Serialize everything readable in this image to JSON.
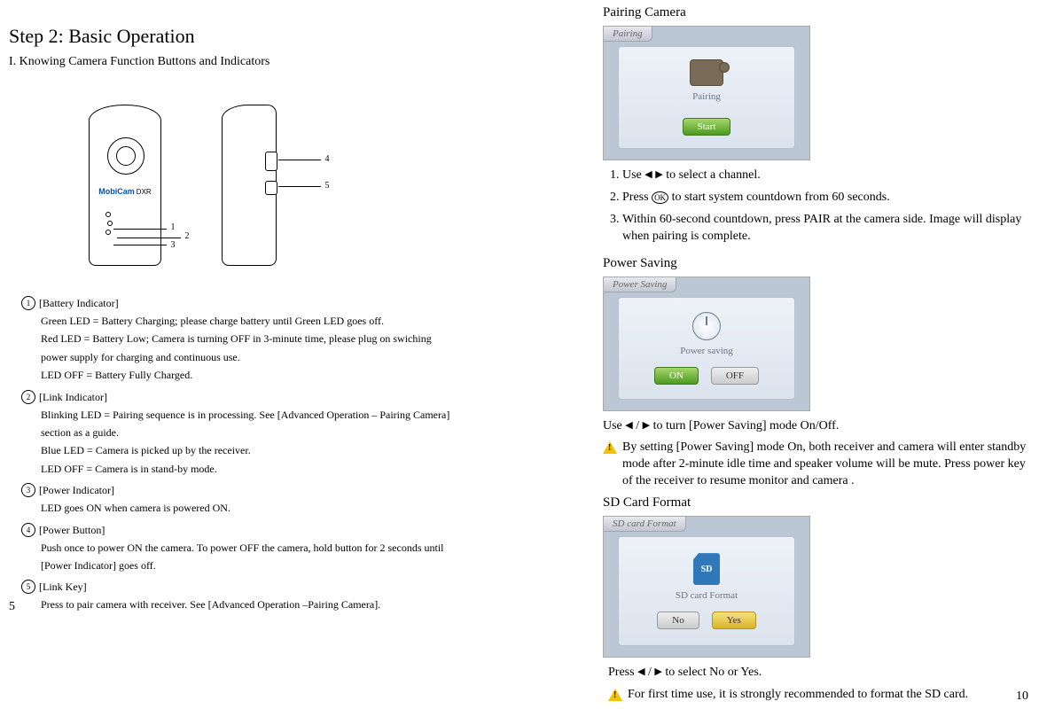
{
  "left": {
    "heading": "Step 2: Basic Operation",
    "section": "I. Knowing Camera Function Buttons and Indicators",
    "logo_brand": "MobiCam",
    "logo_sub": "DXR",
    "callouts": {
      "c1": "1",
      "c2": "2",
      "c3": "3",
      "c4": "4",
      "c5": "5"
    },
    "indicators": [
      {
        "num": "①",
        "title": "[Battery Indicator]",
        "body": "Green LED = Battery Charging; please charge battery until Green LED goes off.\nRed LED =    Battery Low; Camera is turning OFF in 3-minute time, please plug on swiching\npower supply for charging and continuous use.\nLED OFF =   Battery Fully Charged."
      },
      {
        "num": "②",
        "title": "[Link Indicator]",
        "body": "Blinking LED = Pairing sequence is in processing. See [Advanced Operation – Pairing Camera]\nsection as a guide.\nBlue  LED =  Camera is picked up by the receiver.\nLED OFF =  Camera is in stand-by mode."
      },
      {
        "num": "③",
        "title": "[Power Indicator]",
        "body": "LED goes ON when camera is powered ON."
      },
      {
        "num": "④",
        "title": "[Power Button]",
        "body": "Push  once to power ON the camera. To power OFF the camera, hold button for 2 seconds until\n[Power Indicator] goes off."
      },
      {
        "num": "⑤",
        "title": "[Link Key]",
        "body": "Press to pair camera with receiver. See [Advanced Operation –Pairing Camera]."
      }
    ],
    "page_num": "5"
  },
  "right": {
    "pairing": {
      "title": "Pairing Camera",
      "tab": "Pairing",
      "icon_label": "Pairing",
      "start_label": "Start",
      "steps": {
        "s1_pre": "Use ",
        "s1_post": " to select a channel.",
        "s2_pre": "Press ",
        "s2_mid": " to start system countdown from 60 seconds.",
        "s3": "Within 60-second countdown, press PAIR at the camera side. Image will display when pairing is complete."
      }
    },
    "power": {
      "title": "Power Saving",
      "tab": "Power Saving",
      "icon_label": "Power saving",
      "on": "ON",
      "off": "OFF",
      "text_pre": "Use  ",
      "text_mid": " / ",
      "text_post": " to turn [Power Saving] mode On/Off.",
      "warn": "By setting [Power Saving] mode On, both receiver and camera will enter standby mode after 2-minute idle time and speaker volume will be mute. Press power key of the receiver to resume monitor and camera ."
    },
    "sd": {
      "title": "SD Card Format",
      "tab": "SD card Format",
      "icon_label": "SD card Format",
      "sd_text": "SD",
      "no": "No",
      "yes": "Yes",
      "text_pre": "Press  ",
      "text_mid": " / ",
      "text_post": "  to select No or Yes.",
      "warn": "For first time use, it is strongly recommended to format the SD card."
    },
    "page_num": "10"
  },
  "glyphs": {
    "left_tri": "◀",
    "right_tri": "▶",
    "ok": "OK"
  }
}
